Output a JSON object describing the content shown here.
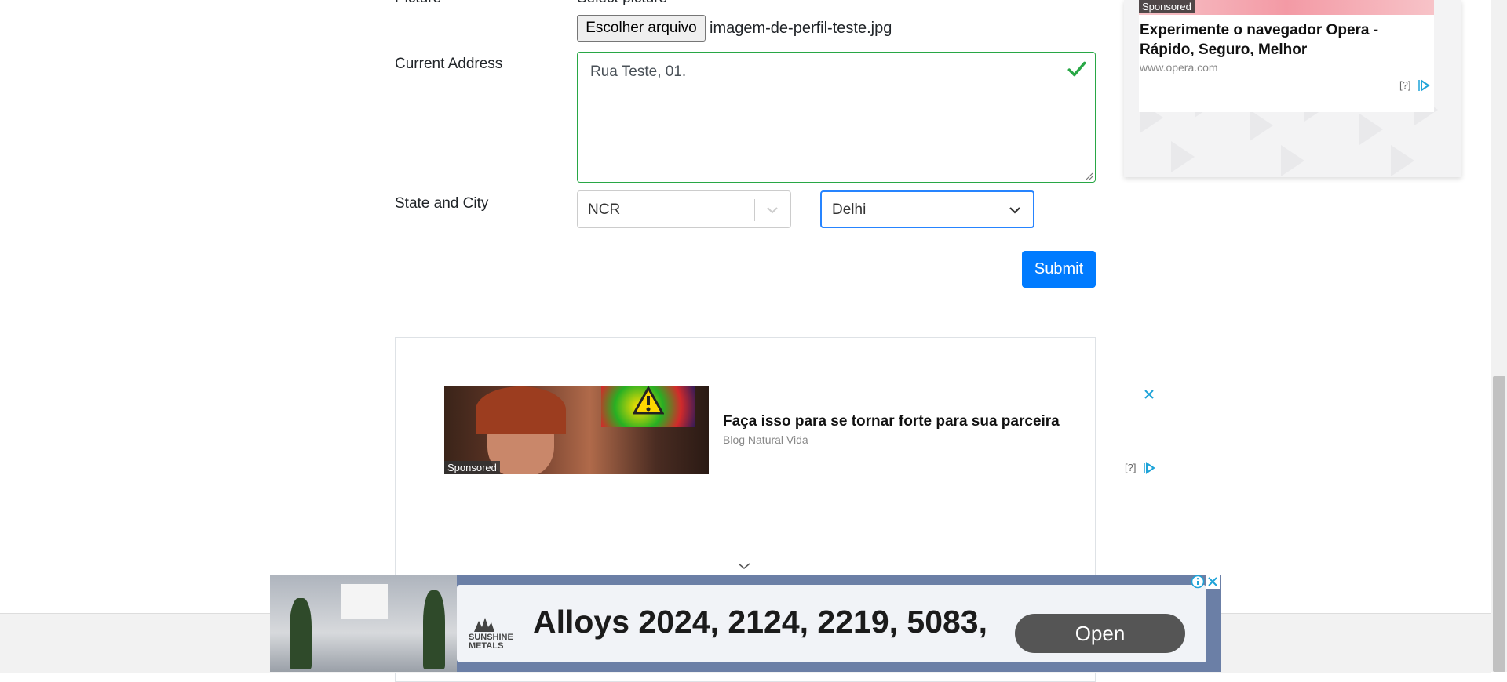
{
  "form": {
    "picture_label": "Picture",
    "picture_hint": "Select picture",
    "file_button": "Escolher arquivo",
    "file_name": "imagem-de-perfil-teste.jpg",
    "address_label": "Current Address",
    "address_value": "Rua Teste, 01.",
    "state_city_label": "State and City",
    "state_value": "NCR",
    "city_value": "Delhi",
    "submit_label": "Submit"
  },
  "side_ad": {
    "sponsored": "Sponsored",
    "title_line1": "Experimente o navegador Opera -",
    "title_line2": "Rápido, Seguro, Melhor",
    "source": "www.opera.com",
    "choice": "[?]"
  },
  "inline_ad": {
    "sponsored": "Sponsored",
    "title": "Faça isso para se tornar forte para sua parceira",
    "source": "Blog Natural Vida",
    "choice": "[?]"
  },
  "sticky_ad": {
    "brand_line1": "SUNSHINE",
    "brand_line2": "METALS",
    "headline": "Alloys 2024, 2124, 2219, 5083,",
    "open_label": "Open"
  },
  "colors": {
    "primary": "#007bff",
    "valid": "#28a745",
    "adchoice": "#1ea3d8"
  }
}
